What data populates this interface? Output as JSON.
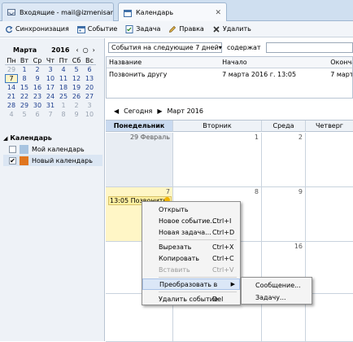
{
  "tabs": [
    {
      "title": "Входящие - mail@izmenisam...",
      "icon": "inbox-icon"
    },
    {
      "title": "Календарь",
      "icon": "calendar-icon"
    }
  ],
  "toolbar": {
    "sync": "Синхронизация",
    "event": "Событие",
    "task": "Задача",
    "edit": "Правка",
    "delete": "Удалить"
  },
  "minical": {
    "month": "Марта",
    "year": "2016",
    "nav_prev": "‹",
    "nav_today": "○",
    "nav_next": "›",
    "dow": [
      "Пн",
      "Вт",
      "Ср",
      "Чт",
      "Пт",
      "Сб",
      "Вс"
    ],
    "weeks": [
      [
        "29",
        "1",
        "2",
        "3",
        "4",
        "5",
        "6"
      ],
      [
        "7",
        "8",
        "9",
        "10",
        "11",
        "12",
        "13"
      ],
      [
        "14",
        "15",
        "16",
        "17",
        "18",
        "19",
        "20"
      ],
      [
        "21",
        "22",
        "23",
        "24",
        "25",
        "26",
        "27"
      ],
      [
        "28",
        "29",
        "30",
        "31",
        "1",
        "2",
        "3"
      ],
      [
        "4",
        "5",
        "6",
        "7",
        "8",
        "9",
        "10"
      ]
    ]
  },
  "calendars": {
    "title": "Календарь",
    "items": [
      {
        "name": "Мой календарь",
        "checked": false,
        "color": "#a8c4e0"
      },
      {
        "name": "Новый календарь",
        "checked": true,
        "color": "#e0761f"
      }
    ]
  },
  "filter": {
    "period": "События на следующие 7 дней",
    "contains_label": "содержат"
  },
  "events_list": {
    "headers": [
      "Название",
      "Начало",
      "Окончан"
    ],
    "rows": [
      [
        "Позвонить другу",
        "7 марта 2016 г. 13:05",
        "7 марта"
      ]
    ]
  },
  "calnav": {
    "today": "Сегодня",
    "month_label": "Март 2016"
  },
  "month": {
    "days": [
      "Понедельник",
      "Вторник",
      "Среда",
      "Четверг"
    ],
    "row1": [
      "29 Февраль",
      "1",
      "2",
      ""
    ],
    "row2": [
      "7",
      "8",
      "9",
      ""
    ],
    "row3": [
      "",
      "",
      "16",
      ""
    ],
    "event_chip": "13:05 Позвонить ..."
  },
  "context_menu": {
    "open": "Открыть",
    "new_event": "Новое событие...",
    "new_event_sc": "Ctrl+I",
    "new_task": "Новая задача...",
    "new_task_sc": "Ctrl+D",
    "cut": "Вырезать",
    "cut_sc": "Ctrl+X",
    "copy": "Копировать",
    "copy_sc": "Ctrl+C",
    "paste": "Вставить",
    "paste_sc": "Ctrl+V",
    "convert": "Преобразовать в",
    "delete": "Удалить событие",
    "delete_sc": "Del"
  },
  "submenu": {
    "message": "Сообщение...",
    "task": "Задачу..."
  }
}
